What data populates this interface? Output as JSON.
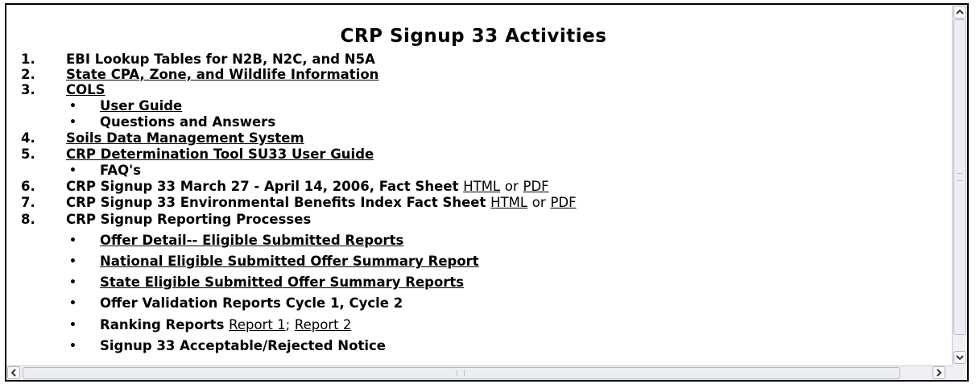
{
  "title": "CRP Signup 33 Activities",
  "items": [
    {
      "num": "1.",
      "text": "EBI Lookup Tables for N2B, N2C, and N5A"
    },
    {
      "num": "2.",
      "text": "State CPA, Zone, and Wildlife Information"
    },
    {
      "num": "3.",
      "text": "COLS"
    },
    {
      "bullet": "User Guide"
    },
    {
      "bullet": "Questions and Answers"
    },
    {
      "num": "4.",
      "text": "Soils Data Management System"
    },
    {
      "num": "5.",
      "text": "CRP Determination Tool SU33 User Guide"
    },
    {
      "bullet": "FAQ's"
    },
    {
      "num": "6.",
      "text": "CRP Signup 33 March 27 - April 14, 2006, Fact Sheet",
      "html": "HTML",
      "or": "or",
      "pdf": "PDF"
    },
    {
      "num": "7.",
      "text": "CRP Signup 33 Environmental Benefits Index Fact Sheet",
      "html": "HTML",
      "or": "or",
      "pdf": "PDF"
    },
    {
      "num": "8.",
      "text": "CRP Signup Reporting Processes"
    },
    {
      "bullet": "Offer Detail-- Eligible Submitted Reports"
    },
    {
      "bullet": "National Eligible Submitted Offer Summary Report"
    },
    {
      "bullet": "State Eligible Submitted Offer Summary Reports"
    },
    {
      "bullet": "Offer Validation Reports  Cycle 1, Cycle 2"
    },
    {
      "bullet": "Ranking Reports",
      "report1": "Report 1",
      "sep": ";",
      "report2": "Report 2"
    },
    {
      "bullet": "Signup 33 Acceptable/Rejected Notice"
    }
  ],
  "bullet_glyph": "•",
  "icons": {
    "scroll_up": "arrow-up",
    "scroll_down": "arrow-down",
    "scroll_left": "arrow-left",
    "scroll_right": "arrow-right"
  }
}
